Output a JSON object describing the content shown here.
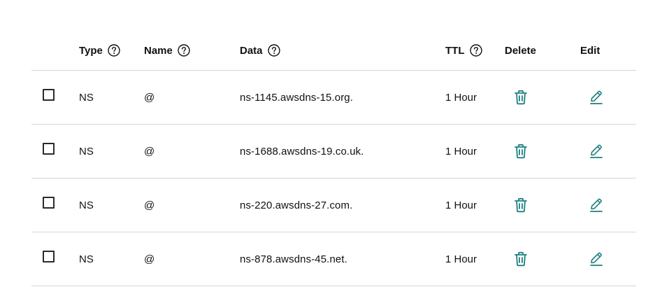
{
  "table": {
    "headers": {
      "type": "Type",
      "name": "Name",
      "data": "Data",
      "ttl": "TTL",
      "delete": "Delete",
      "edit": "Edit"
    },
    "rows": [
      {
        "type": "NS",
        "name": "@",
        "data": "ns-1145.awsdns-15.org.",
        "ttl": "1 Hour"
      },
      {
        "type": "NS",
        "name": "@",
        "data": "ns-1688.awsdns-19.co.uk.",
        "ttl": "1 Hour"
      },
      {
        "type": "NS",
        "name": "@",
        "data": "ns-220.awsdns-27.com.",
        "ttl": "1 Hour"
      },
      {
        "type": "NS",
        "name": "@",
        "data": "ns-878.awsdns-45.net.",
        "ttl": "1 Hour"
      }
    ]
  },
  "icons": {
    "help": "question-circle-icon",
    "delete": "trash-icon",
    "edit": "pencil-icon"
  },
  "colors": {
    "accent": "#1c8080",
    "text": "#111111",
    "divider": "#d6d6d6"
  }
}
